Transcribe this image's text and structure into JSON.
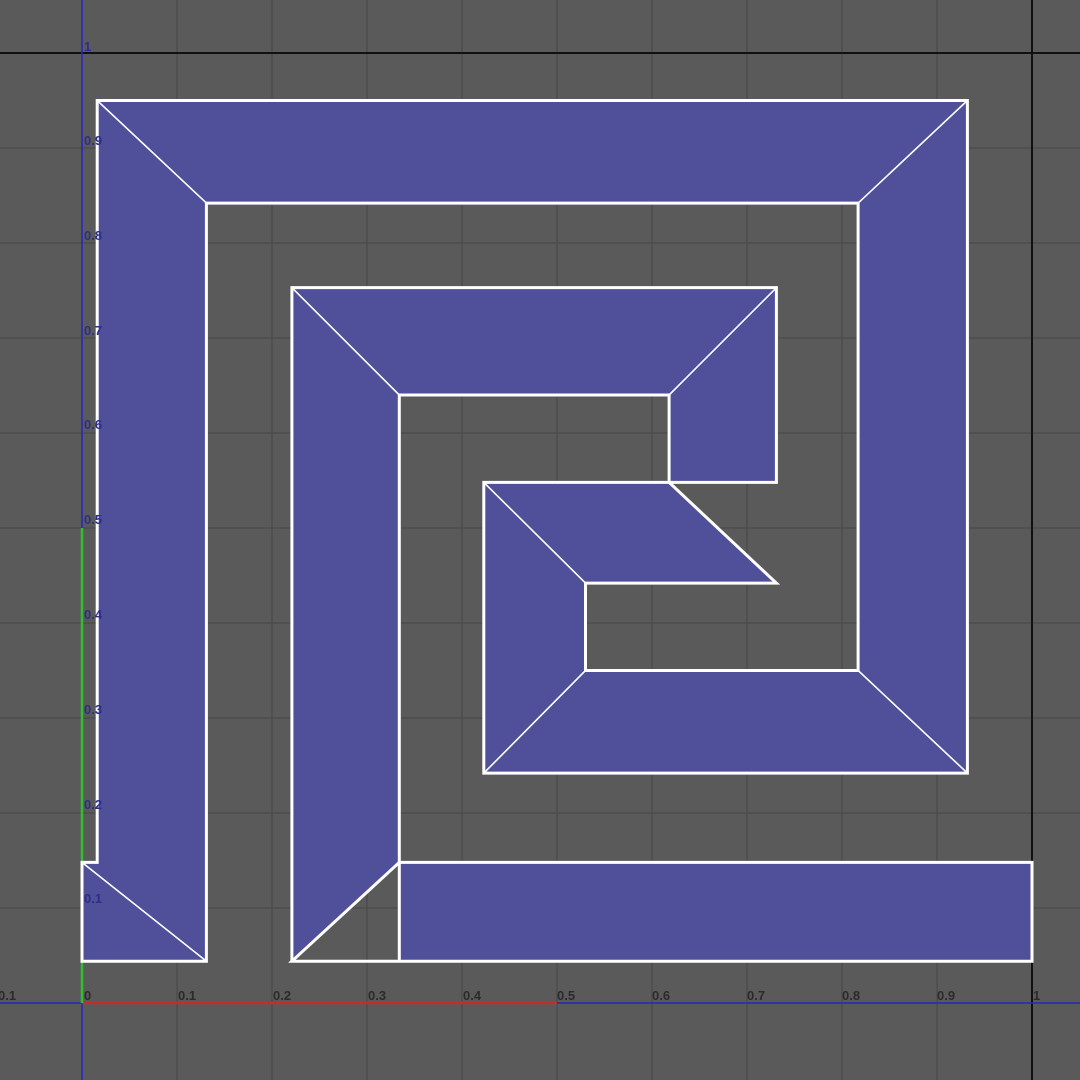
{
  "editor": {
    "u_axis_labels": [
      "0.1",
      "0",
      "0.1",
      "0.2",
      "0.3",
      "0.4",
      "0.5",
      "0.6",
      "0.7",
      "0.8",
      "0.9",
      "1"
    ],
    "v_axis_labels": [
      "0.1",
      "0.2",
      "0.3",
      "0.4",
      "0.5",
      "0.6",
      "0.7",
      "0.8",
      "0.9",
      "1"
    ],
    "colors": {
      "background": "#5a5a5a",
      "grid": "#4a4a4a",
      "uv_fill": "#4f4f9a",
      "uv_edge": "#ffffff",
      "u_axis": "#c0302a",
      "v_axis": "#2fbf2f",
      "axis_line": "#2626c8",
      "boundary": "#111111"
    }
  }
}
